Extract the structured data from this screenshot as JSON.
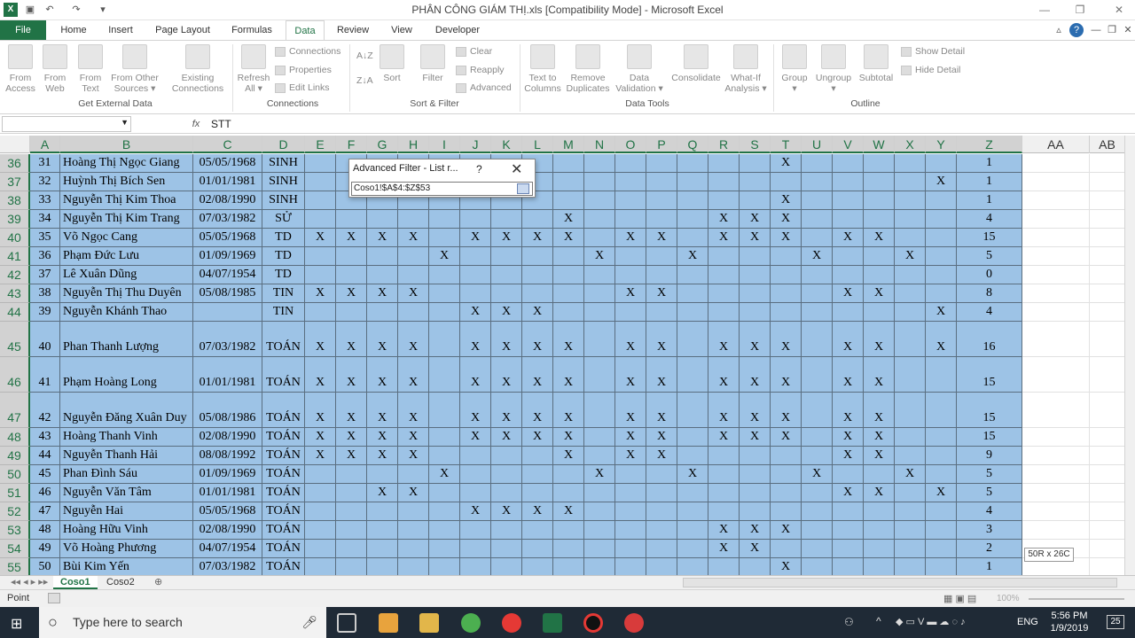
{
  "window": {
    "title": "PHÂN CÔNG GIÁM THỊ.xls  [Compatibility Mode]  -  Microsoft Excel",
    "app_icon": "excel-icon"
  },
  "tabs": [
    {
      "label": "File"
    },
    {
      "label": "Home"
    },
    {
      "label": "Insert"
    },
    {
      "label": "Page Layout"
    },
    {
      "label": "Formulas"
    },
    {
      "label": "Data"
    },
    {
      "label": "Review"
    },
    {
      "label": "View"
    },
    {
      "label": "Developer"
    }
  ],
  "ribbon": {
    "get_external": {
      "buttons": [
        {
          "line1": "From",
          "line2": "Access"
        },
        {
          "line1": "From",
          "line2": "Web"
        },
        {
          "line1": "From",
          "line2": "Text"
        },
        {
          "line1": "From Other",
          "line2": "Sources ▾"
        },
        {
          "line1": "Existing",
          "line2": "Connections"
        }
      ],
      "label": "Get External Data"
    },
    "connections": {
      "refresh": {
        "line1": "Refresh",
        "line2": "All ▾"
      },
      "items": [
        "Connections",
        "Properties",
        "Edit Links"
      ],
      "label": "Connections"
    },
    "sort_filter": {
      "sort": "Sort",
      "filter": "Filter",
      "items": [
        "Clear",
        "Reapply",
        "Advanced"
      ],
      "label": "Sort & Filter"
    },
    "data_tools": {
      "buttons": [
        {
          "line1": "Text to",
          "line2": "Columns"
        },
        {
          "line1": "Remove",
          "line2": "Duplicates"
        },
        {
          "line1": "Data",
          "line2": "Validation ▾"
        },
        {
          "line1": "Consolidate",
          "line2": ""
        },
        {
          "line1": "What-If",
          "line2": "Analysis ▾"
        }
      ],
      "label": "Data Tools"
    },
    "outline": {
      "buttons": [
        {
          "line1": "Group",
          "line2": "▾"
        },
        {
          "line1": "Ungroup",
          "line2": "▾"
        },
        {
          "line1": "Subtotal",
          "line2": ""
        }
      ],
      "items": [
        "Show Detail",
        "Hide Detail"
      ],
      "label": "Outline"
    }
  },
  "formula_bar": {
    "name_box": "",
    "fx": "fx",
    "value": "STT"
  },
  "columns": [
    "A",
    "B",
    "C",
    "D",
    "E",
    "F",
    "G",
    "H",
    "I",
    "J",
    "K",
    "L",
    "M",
    "N",
    "O",
    "P",
    "Q",
    "R",
    "S",
    "T",
    "U",
    "V",
    "W",
    "X",
    "Y",
    "Z",
    "AA",
    "AB"
  ],
  "rows": [
    {
      "r": "36",
      "stt": "31",
      "name": "Hoàng Thị Ngọc Giang",
      "date": "05/05/1968",
      "subj": "SINH",
      "x": [
        "",
        "",
        "",
        "",
        "",
        "",
        "",
        "",
        "",
        "",
        "",
        "",
        "",
        "",
        "",
        "T",
        "",
        "",
        "",
        "",
        ""
      ],
      "xs": [
        15
      ],
      "total": "1"
    },
    {
      "r": "37",
      "stt": "32",
      "name": "Huỳnh Thị Bích Sen",
      "date": "01/01/1981",
      "subj": "SINH",
      "xs": [
        20
      ],
      "total": "1"
    },
    {
      "r": "38",
      "stt": "33",
      "name": "Nguyễn Thị Kim Thoa",
      "date": "02/08/1990",
      "subj": "SINH",
      "xs": [
        15
      ],
      "total": "1"
    },
    {
      "r": "39",
      "stt": "34",
      "name": "Nguyễn Thị Kim Trang",
      "date": "07/03/1982",
      "subj": "SỬ",
      "xs": [
        8,
        13,
        14,
        15
      ],
      "total": "4"
    },
    {
      "r": "40",
      "stt": "35",
      "name": "Võ Ngọc Cang",
      "date": "05/05/1968",
      "subj": "TD",
      "xs": [
        0,
        1,
        2,
        3,
        5,
        6,
        7,
        8,
        10,
        11,
        13,
        14,
        15,
        17,
        18
      ],
      "total": "15"
    },
    {
      "r": "41",
      "stt": "36",
      "name": "Phạm Đức Lưu",
      "date": "01/09/1969",
      "subj": "TD",
      "xs": [
        4,
        9,
        12,
        16,
        19
      ],
      "total": "5"
    },
    {
      "r": "42",
      "stt": "37",
      "name": "Lê Xuân Dũng",
      "date": "04/07/1954",
      "subj": "TD",
      "xs": [],
      "total": "0"
    },
    {
      "r": "43",
      "stt": "38",
      "name": "Nguyễn Thị Thu Duyên",
      "date": "05/08/1985",
      "subj": "TIN",
      "xs": [
        0,
        1,
        2,
        3,
        10,
        11,
        17,
        18
      ],
      "total": "8"
    },
    {
      "r": "44",
      "stt": "39",
      "name": "Nguyễn Khánh Thao",
      "date": "",
      "subj": "TIN",
      "xs": [
        5,
        6,
        7,
        20
      ],
      "total": "4"
    },
    {
      "r": "45",
      "stt": "40",
      "name": "Phan Thanh Lượng",
      "date": "07/03/1982",
      "subj": "TOÁN",
      "xs": [
        0,
        1,
        2,
        3,
        5,
        6,
        7,
        8,
        10,
        11,
        13,
        14,
        15,
        17,
        18,
        20
      ],
      "total": "16",
      "tall": true
    },
    {
      "r": "46",
      "stt": "41",
      "name": "Phạm Hoàng Long",
      "date": "01/01/1981",
      "subj": "TOÁN",
      "xs": [
        0,
        1,
        2,
        3,
        5,
        6,
        7,
        8,
        10,
        11,
        13,
        14,
        15,
        17,
        18
      ],
      "total": "15",
      "tall": true
    },
    {
      "r": "47",
      "stt": "42",
      "name": "Nguyễn Đăng Xuân Duy",
      "date": "05/08/1986",
      "subj": "TOÁN",
      "xs": [
        0,
        1,
        2,
        3,
        5,
        6,
        7,
        8,
        10,
        11,
        13,
        14,
        15,
        17,
        18
      ],
      "total": "15",
      "tall": true
    },
    {
      "r": "48",
      "stt": "43",
      "name": "Hoàng Thanh Vinh",
      "date": "02/08/1990",
      "subj": "TOÁN",
      "xs": [
        0,
        1,
        2,
        3,
        5,
        6,
        7,
        8,
        10,
        11,
        13,
        14,
        15,
        17,
        18
      ],
      "total": "15"
    },
    {
      "r": "49",
      "stt": "44",
      "name": "Nguyễn Thanh Hải",
      "date": "08/08/1992",
      "subj": "TOÁN",
      "xs": [
        0,
        1,
        2,
        3,
        8,
        10,
        11,
        17,
        18
      ],
      "total": "9"
    },
    {
      "r": "50",
      "stt": "45",
      "name": "Phan Đình Sáu",
      "date": "01/09/1969",
      "subj": "TOÁN",
      "xs": [
        4,
        9,
        12,
        16,
        19
      ],
      "total": "5"
    },
    {
      "r": "51",
      "stt": "46",
      "name": "Nguyễn Văn Tâm",
      "date": "01/01/1981",
      "subj": "TOÁN",
      "xs": [
        2,
        3,
        17,
        18,
        20
      ],
      "total": "5"
    },
    {
      "r": "52",
      "stt": "47",
      "name": "Nguyễn Hai",
      "date": "05/05/1968",
      "subj": "TOÁN",
      "xs": [
        5,
        6,
        7,
        8
      ],
      "total": "4"
    },
    {
      "r": "53",
      "stt": "48",
      "name": "Hoàng Hữu Vinh",
      "date": "02/08/1990",
      "subj": "TOÁN",
      "xs": [
        13,
        14,
        15
      ],
      "total": "3"
    },
    {
      "r": "54",
      "stt": "49",
      "name": "Võ Hoàng Phương",
      "date": "04/07/1954",
      "subj": "TOÁN",
      "xs": [
        13,
        14
      ],
      "total": "2"
    },
    {
      "r": "55",
      "stt": "50",
      "name": "Bùi Kim Yến",
      "date": "07/03/1982",
      "subj": "TOÁN",
      "xs": [
        15
      ],
      "total": "1"
    }
  ],
  "mark": "X",
  "dialog": {
    "title": "Advanced Filter - List r...",
    "help": "?",
    "close": "✕",
    "range": "Coso1!$A$4:$Z$53"
  },
  "selection_tooltip": "50R x 26C",
  "sheets": [
    "Coso1",
    "Coso2"
  ],
  "status": {
    "mode": "Point",
    "zoom": "100%"
  },
  "taskbar": {
    "search_placeholder": "Type here to search",
    "lang": "ENG",
    "time": "5:56 PM",
    "date": "1/9/2019",
    "notifications": "25"
  },
  "colors": {
    "accent": "#217346",
    "cell_fill": "#9dc3e6",
    "taskbar": "#1f2a36"
  }
}
